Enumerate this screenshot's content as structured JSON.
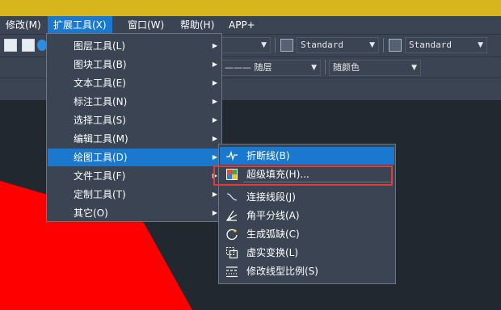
{
  "menubar": {
    "items": [
      {
        "label": "修改(M)"
      },
      {
        "label": "扩展工具(X)"
      },
      {
        "label": "窗口(W)"
      },
      {
        "label": "帮助(H)"
      },
      {
        "label": "APP+"
      }
    ]
  },
  "toolbar": {
    "text_style": "Standard",
    "dim_style": "Standard",
    "linetype": "——— 随层",
    "color": "随颜色"
  },
  "main_menu": {
    "items": [
      {
        "label": "图层工具(L)"
      },
      {
        "label": "图块工具(B)"
      },
      {
        "label": "文本工具(E)"
      },
      {
        "label": "标注工具(N)"
      },
      {
        "label": "选择工具(S)"
      },
      {
        "label": "编辑工具(M)"
      },
      {
        "label": "绘图工具(D)"
      },
      {
        "label": "文件工具(F)"
      },
      {
        "label": "定制工具(T)"
      },
      {
        "label": "其它(O)"
      }
    ]
  },
  "sub_menu": {
    "items": [
      {
        "label": "折断线(B)"
      },
      {
        "label": "超级填充(H)..."
      },
      {
        "label": "连接线段(J)"
      },
      {
        "label": "角平分线(A)"
      },
      {
        "label": "生成弧缺(C)"
      },
      {
        "label": "虚实变换(L)"
      },
      {
        "label": "修改线型比例(S)"
      }
    ]
  },
  "colors": {
    "accent": "#1a78cf",
    "highlight": "#e03a3a",
    "shape": "#ff0000"
  }
}
